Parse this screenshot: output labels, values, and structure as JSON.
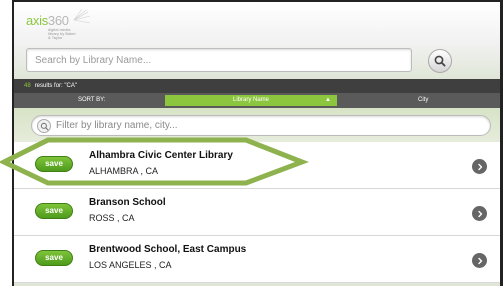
{
  "logo": {
    "brand_main": "axis",
    "brand_num": "360",
    "tagline": "digital media library by Baker & Taylor"
  },
  "search": {
    "placeholder": "Search by Library Name...",
    "value": ""
  },
  "results": {
    "count": "48",
    "text": "results for: \"CA\""
  },
  "sort": {
    "label": "SORT BY:",
    "library_name": "Library Name",
    "library_name_arrow": "▲",
    "city": "City"
  },
  "filter": {
    "placeholder": "Filter by library name, city...",
    "value": ""
  },
  "libraries": [
    {
      "save_label": "save",
      "name": "Alhambra Civic Center Library",
      "location": "ALHAMBRA , CA"
    },
    {
      "save_label": "save",
      "name": "Branson School",
      "location": "ROSS , CA"
    },
    {
      "save_label": "save",
      "name": "Brentwood School, East Campus",
      "location": "LOS ANGELES , CA"
    }
  ],
  "colors": {
    "accent_green": "#8cc63f",
    "highlight_green": "#8db24e",
    "dark_bar": "#3f3f3f"
  },
  "icons": {
    "search": "search-icon",
    "filter": "search-icon",
    "row_chevron": "chevron-right-icon"
  }
}
